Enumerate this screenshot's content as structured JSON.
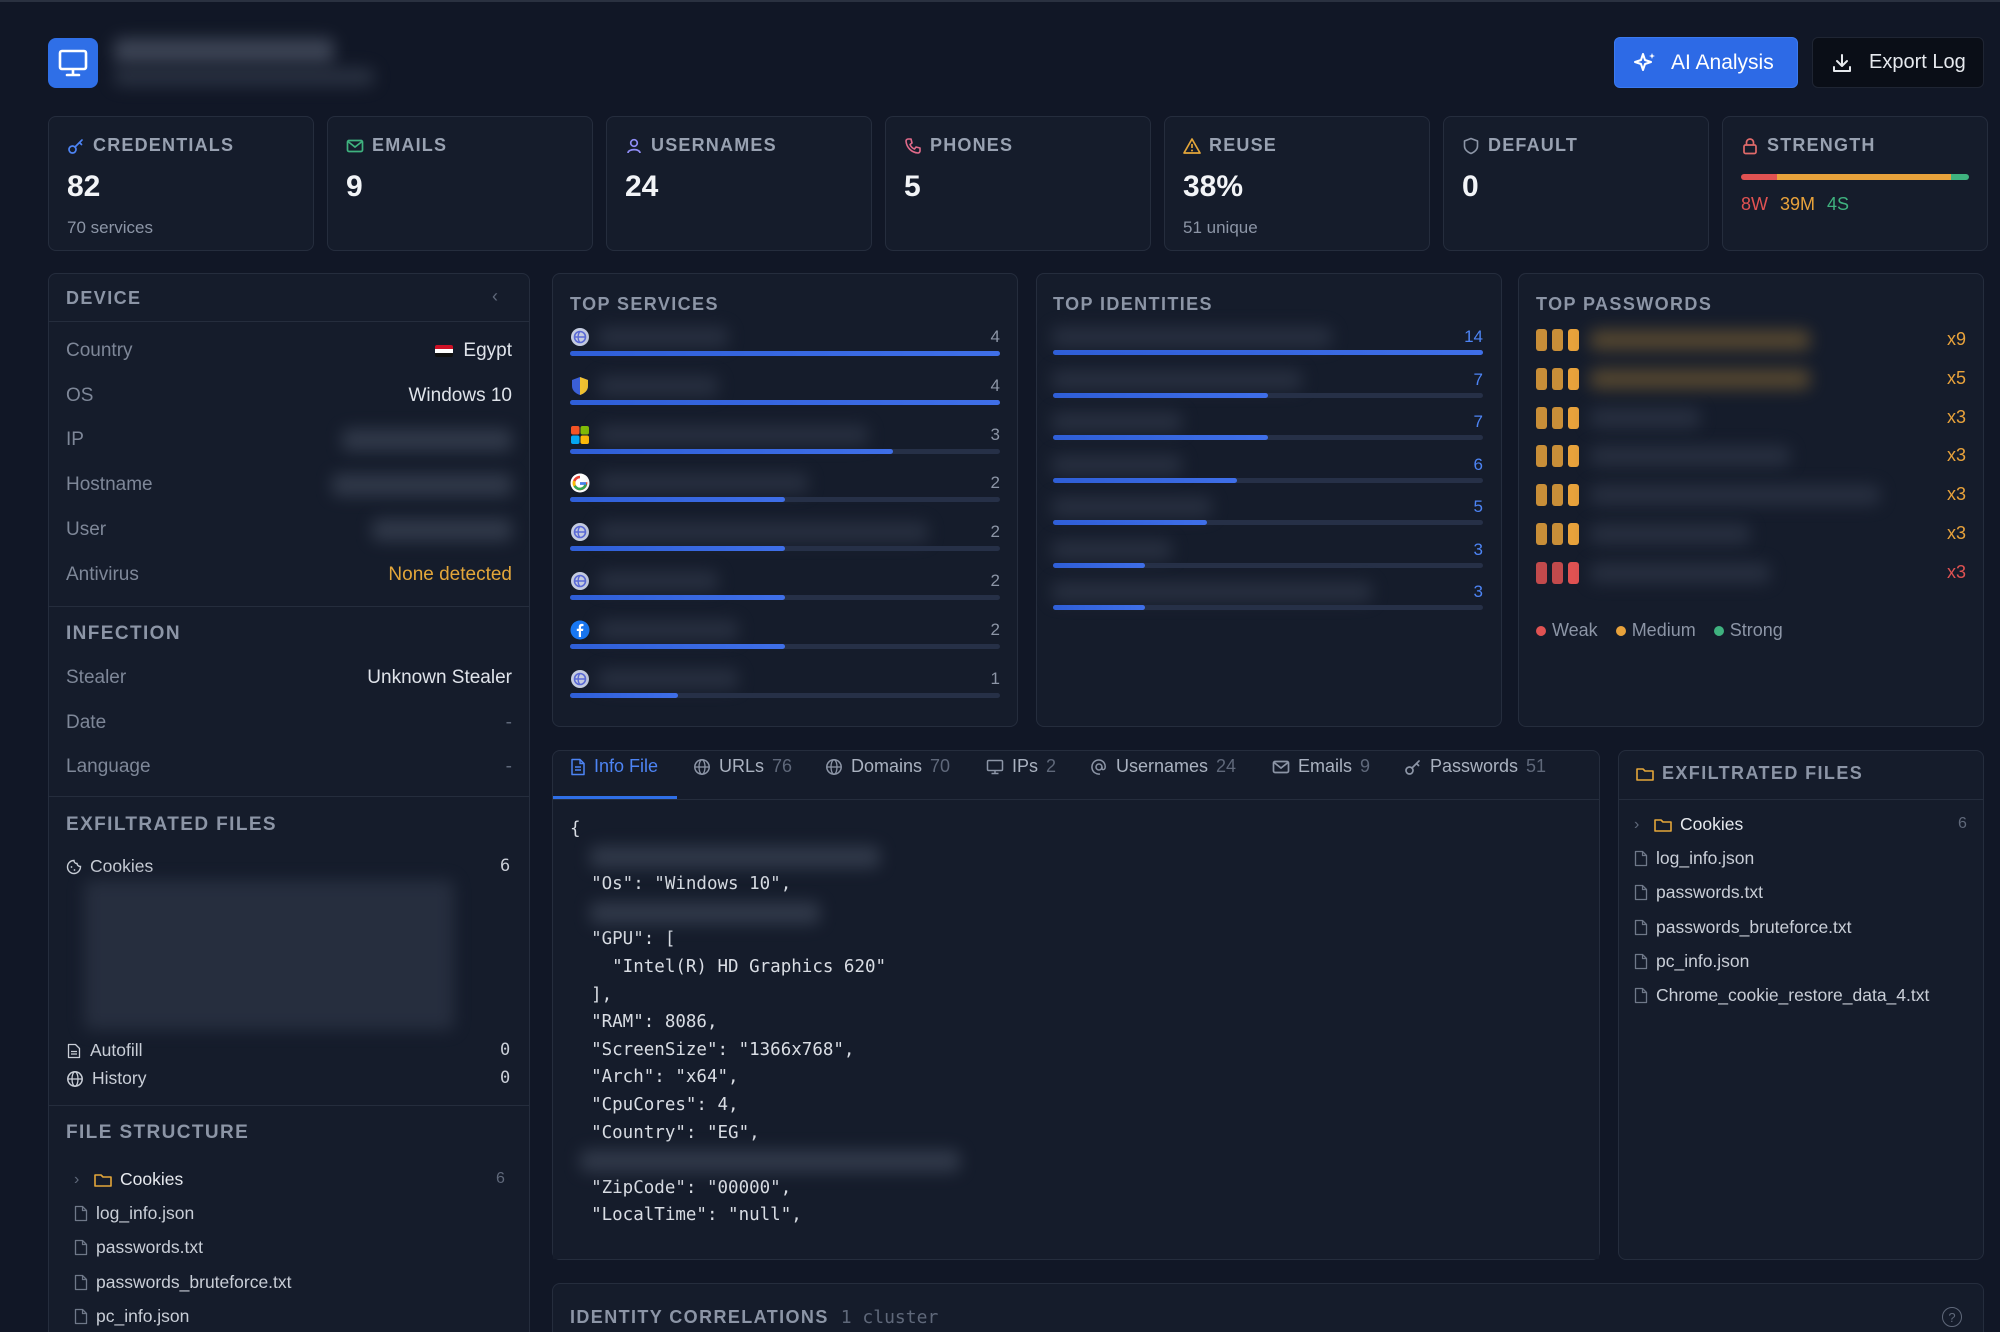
{
  "header": {
    "ai_button": "AI Analysis",
    "export_button": "Export Log"
  },
  "stats": [
    {
      "id": "credentials",
      "label": "CREDENTIALS",
      "value": "82",
      "sub": "70 services",
      "icon": "key-icon",
      "color": "#4d84f4"
    },
    {
      "id": "emails",
      "label": "EMAILS",
      "value": "9",
      "sub": "",
      "icon": "mail-icon",
      "color": "#3fb27f"
    },
    {
      "id": "usernames",
      "label": "USERNAMES",
      "value": "24",
      "sub": "",
      "icon": "user-icon",
      "color": "#8f8cf5"
    },
    {
      "id": "phones",
      "label": "PHONES",
      "value": "5",
      "sub": "",
      "icon": "phone-icon",
      "color": "#e06a8a"
    },
    {
      "id": "reuse",
      "label": "REUSE",
      "value": "38%",
      "sub": "51 unique",
      "icon": "warning-icon",
      "color": "#e3a63a"
    },
    {
      "id": "default",
      "label": "DEFAULT",
      "value": "0",
      "sub": "",
      "icon": "shield-icon",
      "color": "#8c95a6"
    },
    {
      "id": "strength",
      "label": "STRENGTH",
      "value": "",
      "sub": "",
      "icon": "lock-icon",
      "color": "#e06a6a"
    }
  ],
  "strength": {
    "weak": "8W",
    "medium": "39M",
    "strong": "4S",
    "weak_count": 8,
    "medium_count": 39,
    "strong_count": 4,
    "colors": {
      "weak": "#e05252",
      "medium": "#e8a23b",
      "strong": "#3fb27f"
    }
  },
  "device": {
    "title": "DEVICE",
    "rows": [
      {
        "key": "Country",
        "value": "Egypt"
      },
      {
        "key": "OS",
        "value": "Windows 10"
      },
      {
        "key": "IP",
        "value": ""
      },
      {
        "key": "Hostname",
        "value": ""
      },
      {
        "key": "User",
        "value": ""
      },
      {
        "key": "Antivirus",
        "value": "None detected"
      }
    ],
    "infection_title": "INFECTION",
    "infection_rows": [
      {
        "key": "Stealer",
        "value": "Unknown Stealer"
      },
      {
        "key": "Date",
        "value": "-"
      },
      {
        "key": "Language",
        "value": "-"
      }
    ],
    "exfil_title": "EXFILTRATED FILES",
    "exfil": [
      {
        "label": "Cookies",
        "count": "6"
      },
      {
        "label": "Autofill",
        "count": "0"
      },
      {
        "label": "History",
        "count": "0"
      }
    ],
    "structure_title": "FILE STRUCTURE",
    "structure": [
      {
        "label": "Cookies",
        "count": "6",
        "folder": true
      },
      {
        "label": "log_info.json"
      },
      {
        "label": "passwords.txt"
      },
      {
        "label": "passwords_bruteforce.txt"
      },
      {
        "label": "pc_info.json"
      }
    ]
  },
  "top_services": {
    "title": "TOP SERVICES",
    "items": [
      {
        "count": "4",
        "value": 4,
        "icon": "globe-icon"
      },
      {
        "count": "4",
        "value": 4,
        "icon": "shield-icon"
      },
      {
        "count": "3",
        "value": 3,
        "icon": "microsoft-icon"
      },
      {
        "count": "2",
        "value": 2,
        "icon": "google-icon"
      },
      {
        "count": "2",
        "value": 2,
        "icon": "globe-icon"
      },
      {
        "count": "2",
        "value": 2,
        "icon": "globe-icon"
      },
      {
        "count": "2",
        "value": 2,
        "icon": "facebook-icon"
      },
      {
        "count": "1",
        "value": 1,
        "icon": "globe-icon"
      }
    ]
  },
  "top_identities": {
    "title": "TOP IDENTITIES",
    "items": [
      {
        "count": "14",
        "value": 14
      },
      {
        "count": "7",
        "value": 7
      },
      {
        "count": "7",
        "value": 7
      },
      {
        "count": "6",
        "value": 6
      },
      {
        "count": "5",
        "value": 5
      },
      {
        "count": "3",
        "value": 3
      },
      {
        "count": "3",
        "value": 3
      }
    ]
  },
  "top_passwords": {
    "title": "TOP PASSWORDS",
    "items": [
      {
        "count": "x9",
        "strength": "medium"
      },
      {
        "count": "x5",
        "strength": "medium"
      },
      {
        "count": "x3",
        "strength": "medium"
      },
      {
        "count": "x3",
        "strength": "medium"
      },
      {
        "count": "x3",
        "strength": "medium"
      },
      {
        "count": "x3",
        "strength": "medium"
      },
      {
        "count": "x3",
        "strength": "weak"
      }
    ],
    "legend": {
      "weak": "Weak",
      "medium": "Medium",
      "strong": "Strong"
    }
  },
  "tabs": [
    {
      "label": "Info File",
      "count": "",
      "icon": "file-icon",
      "active": true
    },
    {
      "label": "URLs",
      "count": "76",
      "icon": "globe-icon"
    },
    {
      "label": "Domains",
      "count": "70",
      "icon": "globe-icon"
    },
    {
      "label": "IPs",
      "count": "2",
      "icon": "monitor-icon"
    },
    {
      "label": "Usernames",
      "count": "24",
      "icon": "at-icon"
    },
    {
      "label": "Emails",
      "count": "9",
      "icon": "mail-icon"
    },
    {
      "label": "Passwords",
      "count": "51",
      "icon": "key-icon"
    }
  ],
  "info_file": {
    "lines": [
      "{",
      "",
      "  \"Os\": \"Windows 10\",",
      "",
      "  \"GPU\": [",
      "    \"Intel(R) HD Graphics 620\"",
      "  ],",
      "  \"RAM\": 8086,",
      "  \"ScreenSize\": \"1366x768\",",
      "  \"Arch\": \"x64\",",
      "  \"CpuCores\": 4,",
      "  \"Country\": \"EG\",",
      "",
      "  \"ZipCode\": \"00000\",",
      "  \"LocalTime\": \"null\","
    ]
  },
  "exfil_files": {
    "title": "EXFILTRATED FILES",
    "items": [
      {
        "label": "Cookies",
        "count": "6",
        "folder": true
      },
      {
        "label": "log_info.json"
      },
      {
        "label": "passwords.txt"
      },
      {
        "label": "passwords_bruteforce.txt"
      },
      {
        "label": "pc_info.json"
      },
      {
        "label": "Chrome_cookie_restore_data_4.txt"
      }
    ]
  },
  "correlations": {
    "title": "IDENTITY CORRELATIONS",
    "sub": "1 cluster"
  }
}
